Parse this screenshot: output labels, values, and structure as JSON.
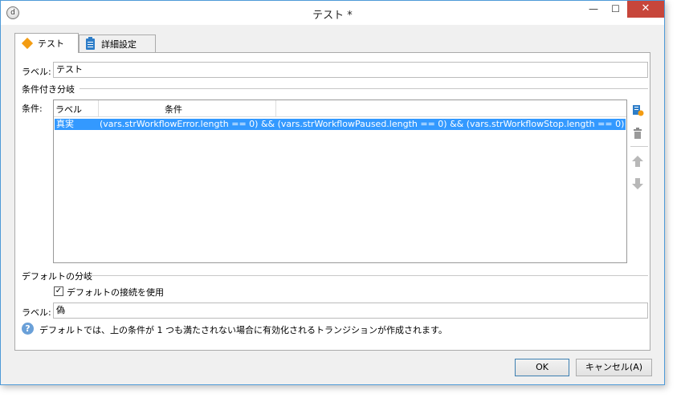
{
  "window": {
    "title": "テスト *",
    "app_icon_glyph": "d"
  },
  "controls": {
    "minimize": "—",
    "maximize": "☐",
    "close": "✕"
  },
  "tabs": [
    {
      "label": "テスト",
      "icon": "diamond-icon",
      "active": true
    },
    {
      "label": "詳細設定",
      "icon": "clipboard-icon",
      "active": false
    }
  ],
  "form": {
    "label_caption": "ラベル:",
    "label_value": "テスト",
    "conditional_group": "条件付き分岐",
    "conditions_caption": "条件:",
    "table": {
      "headers": [
        "ラベル",
        "条件"
      ],
      "rows": [
        {
          "label": "真実",
          "condition": "(vars.strWorkflowError.length == 0) && (vars.strWorkflowPaused.length == 0) && (vars.strWorkflowStop.length == 0)"
        }
      ]
    },
    "default_group": "デフォルトの分岐",
    "use_default_checkbox": "デフォルトの接続を使用",
    "use_default_checked": true,
    "default_label_caption": "ラベル:",
    "default_label_value": "偽",
    "help_text": "デフォルトでは、上の条件が 1 つも満たされない場合に有効化されるトランジションが作成されます。"
  },
  "side_tools": [
    "add-condition-icon",
    "delete-icon",
    "move-up-icon",
    "move-down-icon"
  ],
  "buttons": {
    "ok": "OK",
    "cancel": "キャンセル(A)"
  },
  "colors": {
    "selection": "#3399ff",
    "close_button": "#c7463b",
    "tab_diamond": "#f39c12"
  }
}
